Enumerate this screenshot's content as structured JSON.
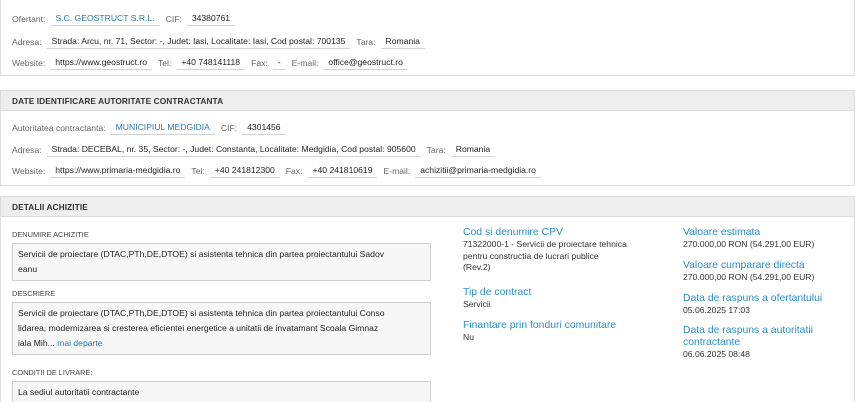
{
  "ofertant": {
    "label": "Ofertant:",
    "name": "S.C. GEOSTRUCT S.R.L.",
    "cif_label": "CIF:",
    "cif": "34380761",
    "address_label": "Adresa:",
    "address": "Strada: Arcu, nr. 71, Sector: -, Judet: Iasi, Localitate: Iasi, Cod postal: 700135",
    "country_label": "Tara:",
    "country": "Romania",
    "website_label": "Website:",
    "website": "https://www.geostruct.ro",
    "tel_label": "Tel:",
    "tel": "+40 748141118",
    "fax_label": "Fax:",
    "fax": "-",
    "email_label": "E-mail:",
    "email": "office@geostruct.ro"
  },
  "autoritate": {
    "header": "DATE IDENTIFICARE AUTORITATE CONTRACTANTA",
    "label": "Autoritatea contractanta:",
    "name": "MUNICIPIUL MEDGIDIA",
    "cif_label": "CIF:",
    "cif": "4301456",
    "address_label": "Adresa:",
    "address": "Strada: DECEBAL, nr. 35, Sector: -, Judet: Constanta, Localitate: Medgidia, Cod postal: 905600",
    "country_label": "Tara:",
    "country": "Romania",
    "website_label": "Website:",
    "website": "https://www.primaria-medgidia.ro",
    "tel_label": "Tel:",
    "tel": "+40 241812300",
    "fax_label": "Fax:",
    "fax": "+40 241810619",
    "email_label": "E-mail:",
    "email": "achizitii@primaria-medgidia.ro"
  },
  "achizitie": {
    "header": "DETALII ACHIZITIE",
    "denumire_label": "DENUMIRE ACHIZITIE",
    "denumire_l1": "Servicii de proiectare (DTAC,PTh,DE,DTOE) si asistenta tehnica din partea proiectantului Sadov",
    "denumire_l2": "eanu",
    "descriere_label": "DESCRIERE",
    "descriere_l1": "Servicii de proiectare (DTAC,PTh,DE,DTOE) si asistenta tehnica din partea proiectantului Conso",
    "descriere_l2": "lidarea, modernizarea si cresterea eficientei energetice a unitatii de invatamant Scoala Gimnaz",
    "descriere_l3": "iala Mih...",
    "more": "mai departe",
    "conditii_label": "CONDITII DE LIVRARE:",
    "conditii": "La sediul autoritatii contractante",
    "cpv_title": "Cod si denumire CPV",
    "cpv_l1": "71322000-1 - Servicii de proiectare tehnica",
    "cpv_l2": "pentru constructia de lucrari publice",
    "cpv_l3": "(Rev.2)",
    "tip_title": "Tip de contract",
    "tip": "Servicii",
    "fonduri_title": "Finantare prin fonduri comunitare",
    "fonduri": "Nu",
    "valoare_title": "Valoare estimata",
    "valoare": "270.000,00 RON (54.291,00 EUR)",
    "cumparare_title": "Valoare cumparare directa",
    "cumparare": "270.000,00 RON (54.291,00 EUR)",
    "raspuns_of_title": "Data de raspuns a ofertantului",
    "raspuns_of": "05.06.2025 17:03",
    "raspuns_aut_title_l1": "Data de raspuns a autoritatii",
    "raspuns_aut_title_l2": "contractante",
    "raspuns_aut": "06.06.2025 08:48"
  },
  "colors": {
    "link": "#2a7ab8",
    "section_title": "#2a8fd0",
    "header_bg": "#eeeeee"
  }
}
